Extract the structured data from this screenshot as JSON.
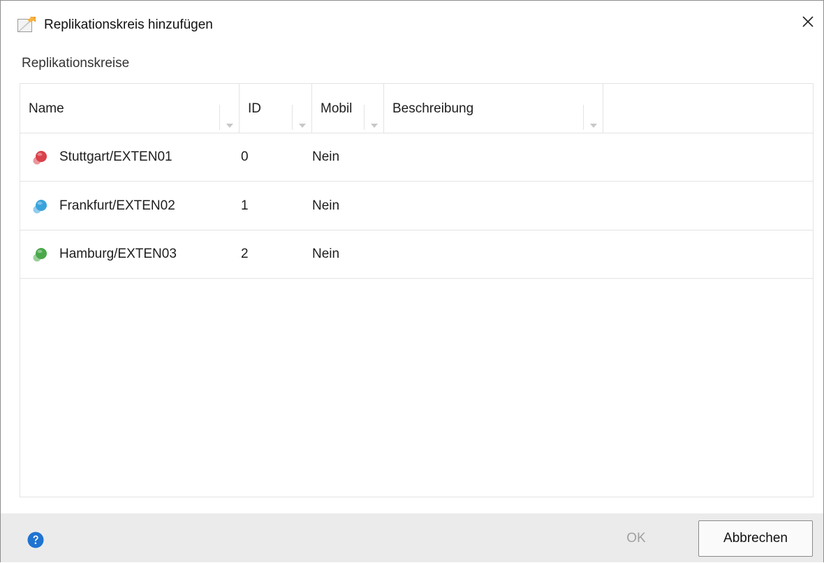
{
  "window": {
    "title": "Replikationskreis hinzufügen",
    "close_icon": "close-icon",
    "app_icon": "replication-app-icon"
  },
  "section": {
    "label": "Replikationskreise"
  },
  "grid": {
    "columns": [
      {
        "key": "name",
        "label": "Name"
      },
      {
        "key": "id",
        "label": "ID"
      },
      {
        "key": "mobil",
        "label": "Mobil"
      },
      {
        "key": "beschreibung",
        "label": "Beschreibung"
      }
    ],
    "rows": [
      {
        "icon": "red-replication-icon",
        "icon_color": "#d9414b",
        "name": "Stuttgart/EXTEN01",
        "id": "0",
        "mobil": "Nein",
        "beschreibung": ""
      },
      {
        "icon": "blue-replication-icon",
        "icon_color": "#3aa3dc",
        "name": "Frankfurt/EXTEN02",
        "id": "1",
        "mobil": "Nein",
        "beschreibung": ""
      },
      {
        "icon": "green-replication-icon",
        "icon_color": "#4aa84a",
        "name": "Hamburg/EXTEN03",
        "id": "2",
        "mobil": "Nein",
        "beschreibung": ""
      }
    ]
  },
  "footer": {
    "help_icon": "help-icon",
    "ok_label": "OK",
    "cancel_label": "Abbrechen"
  },
  "colors": {
    "accent": "#1f73d1",
    "footer_bg": "#ebebec",
    "disabled_text": "#a0a0a0"
  }
}
